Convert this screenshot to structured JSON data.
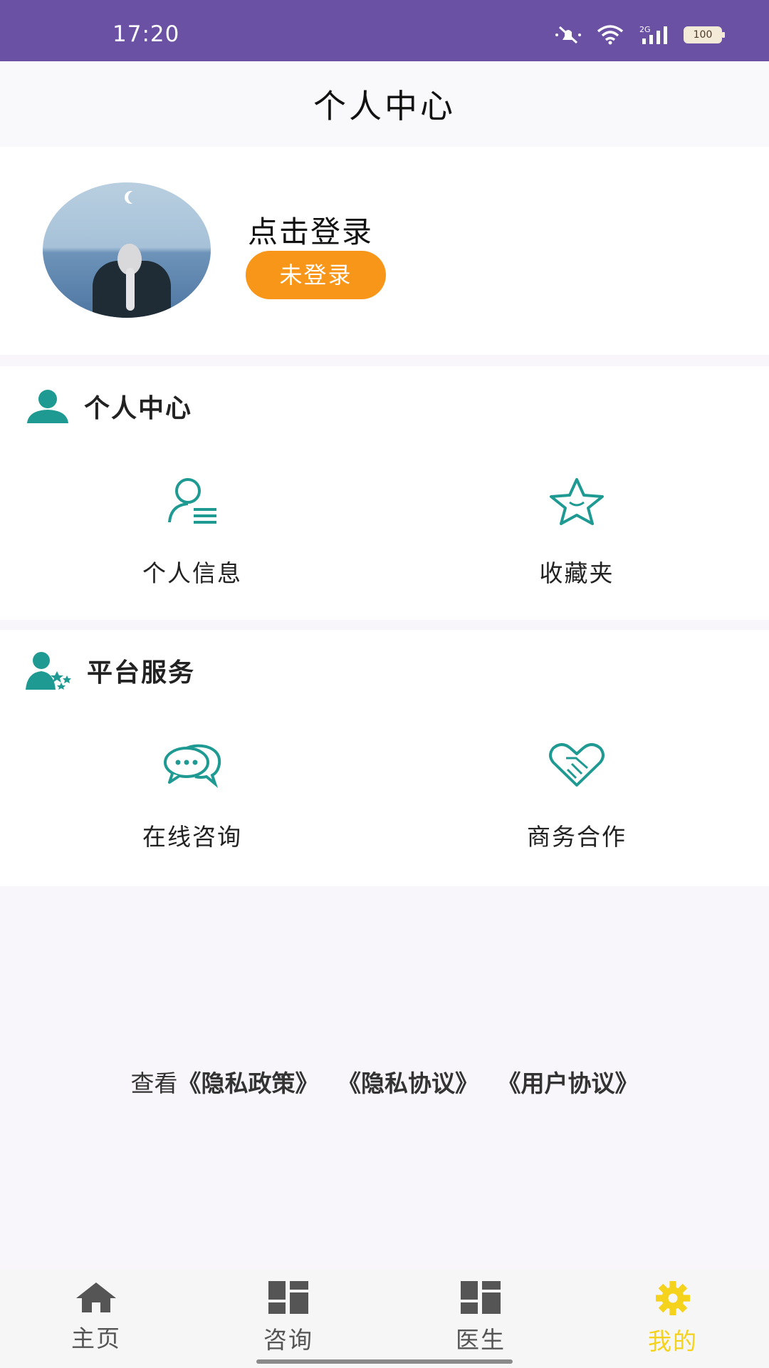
{
  "status_bar": {
    "time": "17:20",
    "battery": "100"
  },
  "header": {
    "title": "个人中心"
  },
  "profile": {
    "login_prompt": "点击登录",
    "status_badge": "未登录"
  },
  "personal_section": {
    "title": "个人中心",
    "items": [
      {
        "label": "个人信息",
        "icon": "user-info-icon"
      },
      {
        "label": "收藏夹",
        "icon": "star-icon"
      }
    ]
  },
  "service_section": {
    "title": "平台服务",
    "items": [
      {
        "label": "在线咨询",
        "icon": "chat-bubbles-icon"
      },
      {
        "label": "商务合作",
        "icon": "handshake-heart-icon"
      }
    ]
  },
  "links": {
    "prefix": "查看",
    "privacy_policy": "《隐私政策》",
    "privacy_agreement": "《隐私协议》",
    "user_agreement": "《用户协议》"
  },
  "tabs": [
    {
      "label": "主页",
      "icon": "home-icon"
    },
    {
      "label": "咨询",
      "icon": "grid-icon"
    },
    {
      "label": "医生",
      "icon": "grid-icon"
    },
    {
      "label": "我的",
      "icon": "gear-icon",
      "active": true
    }
  ],
  "colors": {
    "status_bar": "#6a51a3",
    "accent_teal": "#1f9a92",
    "badge_orange": "#f8961a",
    "active_tab": "#f5d21b"
  }
}
